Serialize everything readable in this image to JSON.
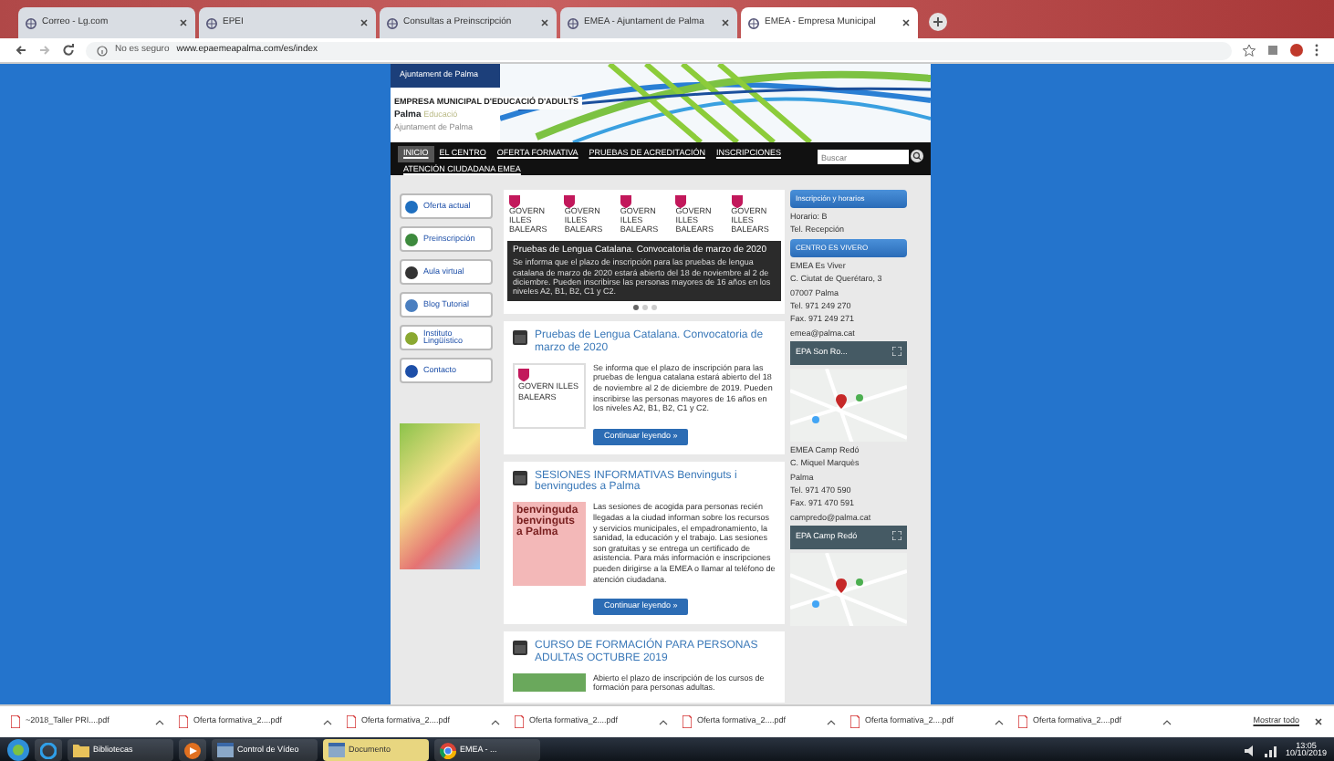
{
  "browser": {
    "tabs": [
      {
        "title": "Correo - Lg.com",
        "selected": false
      },
      {
        "title": "EPEI",
        "selected": false
      },
      {
        "title": "Consultas a Preinscripción",
        "selected": false
      },
      {
        "title": "EMEA - Ajuntament de Palma",
        "selected": false
      },
      {
        "title": "EMEA - Empresa Municipal",
        "selected": true
      }
    ],
    "security": "No es seguro",
    "address": "www.epaemeapalma.com/es/index"
  },
  "site": {
    "logo": "Ajuntament de Palma",
    "org": "EMPRESA MUNICIPAL D'EDUCACIÓ D'ADULTS",
    "brand": "Palma",
    "brand_sub": "Educació",
    "brand_note": "Ajuntament de Palma",
    "nav": [
      {
        "label": "INICIO",
        "selected": true
      },
      {
        "label": "EL CENTRO",
        "selected": false
      },
      {
        "label": "OFERTA FORMATIVA",
        "selected": false
      },
      {
        "label": "PRUEBAS DE ACREDITACIÓN",
        "selected": false
      },
      {
        "label": "INSCRIPCIONES",
        "selected": false
      },
      {
        "label": "ATENCIÓN CIUDADANA EMEA",
        "selected": false
      }
    ],
    "search": {
      "placeholder": "Buscar"
    },
    "sidebar": [
      {
        "label": "Oferta actual",
        "color": "#1f6fc0"
      },
      {
        "label": "Preinscripción",
        "color": "#3d8a3d"
      },
      {
        "label": "Aula virtual",
        "color": "#333333"
      },
      {
        "label": "Blog Tutorial",
        "color": "#4a7fc0"
      },
      {
        "label": "Instituto Lingüístico",
        "color": "#8aa830"
      },
      {
        "label": "Contacto",
        "color": "#1d4fa8"
      }
    ],
    "slider": {
      "logos": [
        "GOVERN ILLES BALEARS",
        "GOVERN ILLES BALEARS",
        "GOVERN ILLES BALEARS",
        "GOVERN ILLES BALEARS",
        "GOVERN ILLES BALEARS"
      ],
      "caption_title": "Pruebas de Lengua Catalana. Convocatoria de marzo de 2020",
      "caption_text": "Se informa que el plazo de inscripción para las pruebas de lengua catalana de marzo de 2020 estará abierto del 18 de noviembre al 2 de diciembre. Pueden inscribirse las personas mayores de 16 años en los niveles A2, B1, B2, C1 y C2.",
      "dots": [
        {
          "selected": true
        },
        {
          "selected": false
        },
        {
          "selected": false
        }
      ]
    },
    "posts": [
      {
        "kind": "logo",
        "title": "Pruebas de Lengua Catalana. Convocatoria de marzo de 2020",
        "image_text": "GOVERN ILLES BALEARS",
        "text": "Se informa que el plazo de inscripción para las pruebas de lengua catalana estará abierto del 18 de noviembre al 2 de diciembre de 2019. Pueden inscribirse las personas mayores de 16 años en los niveles A2, B1, B2, C1 y C2.",
        "button": "Continuar leyendo »"
      },
      {
        "kind": "banner",
        "title": "SESIONES INFORMATIVAS Benvinguts i benvingudes a Palma",
        "image_text": "benvinguda benvinguts a Palma",
        "text": "Las sesiones de acogida para personas recién llegadas a la ciudad informan sobre los recursos y servicios municipales, el empadronamiento, la sanidad, la educación y el trabajo. Las sesiones son gratuitas y se entrega un certificado de asistencia. Para más información e inscripciones pueden dirigirse a la EMEA o llamar al teléfono de atención ciudadana.",
        "button": "Continuar leyendo »"
      },
      {
        "kind": "photo",
        "title": "CURSO DE FORMACIÓN PARA PERSONAS ADULTAS OCTUBRE 2019",
        "text": "Abierto el plazo de inscripción de los cursos de formación para personas adultas."
      }
    ],
    "right": {
      "box_title": "Inscripción y horarios",
      "box_lines": [
        "Horario: B",
        "Tel. Recepción"
      ],
      "centre_title": "CENTRO ES VIVERO",
      "centre_lines": [
        "EMEA Es Viver",
        "C. Ciutat de Querétaro, 3",
        "07007 Palma",
        "Tel. 971 249 270",
        "Fax. 971 249 271",
        "emea@palma.cat"
      ],
      "maps": [
        {
          "title": "EPA Son Ro...",
          "lines": [
            "EMEA Camp Redó",
            "C. Miquel Marquès",
            "Palma",
            "Tel. 971 470 590",
            "Fax. 971 470 591",
            "campredo@palma.cat"
          ]
        },
        {
          "title": "EPA Camp Redó"
        }
      ]
    }
  },
  "downloads": {
    "files": [
      "~2018_Taller PRI....pdf",
      "Oferta formativa_2....pdf",
      "Oferta formativa_2....pdf",
      "Oferta formativa_2....pdf",
      "Oferta formativa_2....pdf",
      "Oferta formativa_2....pdf",
      "Oferta formativa_2....pdf"
    ],
    "show_all": "Mostrar todo"
  },
  "taskbar": {
    "items": [
      {
        "kind": "ie",
        "selected": false
      },
      {
        "kind": "folder",
        "label": "Bibliotecas",
        "selected": false
      },
      {
        "kind": "media",
        "selected": false
      },
      {
        "kind": "app",
        "label": "Control de Vídeo",
        "selected": false
      },
      {
        "kind": "app",
        "label": "Documento",
        "selected": true
      },
      {
        "kind": "chrome",
        "label": "EMEA - ...",
        "selected": false
      }
    ],
    "time": "13:05",
    "date": "10/10/2019"
  }
}
